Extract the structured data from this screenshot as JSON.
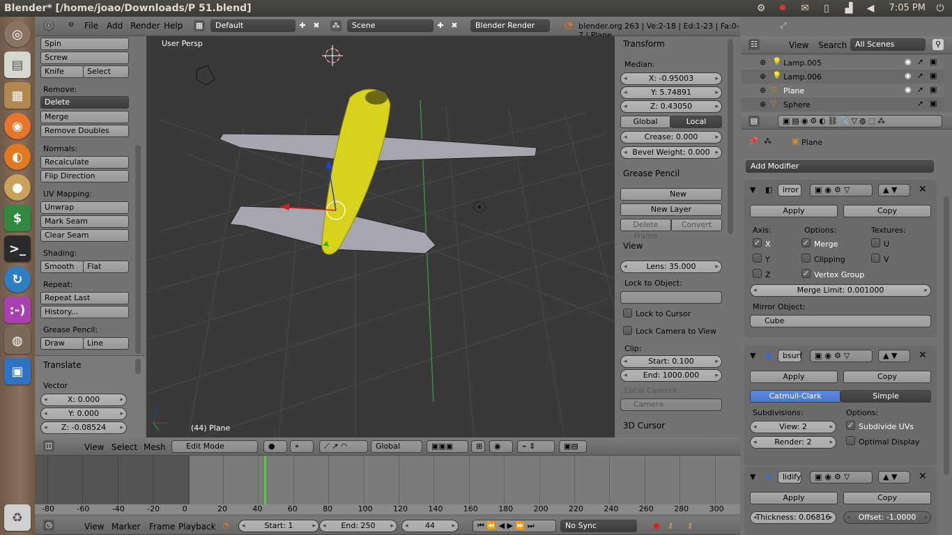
{
  "window": {
    "title": "Blender* [/home/joao/Downloads/P 51.blend]",
    "clock": "7:05 PM"
  },
  "tray_icons": [
    "gear-icon",
    "alert-icon",
    "mail-icon",
    "battery-icon",
    "signal-icon",
    "volume-icon",
    "power-icon"
  ],
  "launcher": [
    "dash",
    "files",
    "archive",
    "firefox",
    "blender",
    "cookie",
    "money",
    "terminal",
    "sync",
    "chat",
    "disc",
    "workspace",
    "trash"
  ],
  "info": {
    "menus": [
      "File",
      "Add",
      "Render",
      "Help"
    ],
    "layout": "Default",
    "scene": "Scene",
    "engine": "Blender Render",
    "stats": "blender.org 263 | Ve:2-18 | Ed:1-23 | Fa:0-7 | Plane"
  },
  "toolshelf": {
    "spin": "Spin",
    "screw": "Screw",
    "knife": "Knife",
    "select": "Select",
    "remove": "Remove:",
    "delete": "Delete",
    "merge": "Merge",
    "remove_doubles": "Remove Doubles",
    "normals": "Normals:",
    "recalculate": "Recalculate",
    "flip": "Flip Direction",
    "uv": "UV Mapping:",
    "unwrap": "Unwrap",
    "mark_seam": "Mark Seam",
    "clear_seam": "Clear Seam",
    "shading": "Shading:",
    "smooth": "Smooth",
    "flat": "Flat",
    "repeat": "Repeat:",
    "repeat_last": "Repeat Last",
    "history": "History...",
    "gp": "Grease Pencil:",
    "draw": "Draw",
    "line": "Line",
    "translate": "Translate",
    "vector": "Vector",
    "x": "X: 0.000",
    "y": "Y: 0.000",
    "z": "Z: -0.08524"
  },
  "viewport": {
    "label": "User Persp",
    "object": "(44) Plane"
  },
  "properties": {
    "transform": "Transform",
    "median": "Median:",
    "x": "X: -0.95003",
    "y": "Y: 5.74891",
    "z": "Z: 0.43050",
    "global": "Global",
    "local": "Local",
    "crease": "Crease: 0.000",
    "bevel": "Bevel Weight: 0.000",
    "grease": "Grease Pencil",
    "new": "New",
    "new_layer": "New Layer",
    "delete_frame": "Delete Frame",
    "convert": "Convert",
    "view": "View",
    "lens": "Lens: 35.000",
    "lock_obj": "Lock to Object:",
    "lock_cursor": "Lock to Cursor",
    "lock_cam": "Lock Camera to View",
    "clip": "Clip:",
    "start": "Start: 0.100",
    "end": "End: 1000.000",
    "local_cam": "Local Camera:",
    "camera": "Camera",
    "cursor": "3D Cursor"
  },
  "view3d_header": {
    "menus": [
      "View",
      "Select",
      "Mesh"
    ],
    "mode": "Edit Mode",
    "orientation": "Global"
  },
  "timeline": {
    "ticks": [
      "-80",
      "-60",
      "-40",
      "-20",
      "0",
      "20",
      "40",
      "60",
      "80",
      "100",
      "120",
      "140",
      "160",
      "180",
      "200",
      "220",
      "240",
      "260",
      "280",
      "300"
    ],
    "menus": [
      "View",
      "Marker",
      "Frame",
      "Playback"
    ],
    "start": "Start: 1",
    "end": "End: 250",
    "frame": "44",
    "sync": "No Sync",
    "current_frame": 44
  },
  "outliner": {
    "menus": [
      "View",
      "Search"
    ],
    "filter": "All Scenes",
    "items": [
      "Lamp.005",
      "Lamp.006",
      "Plane",
      "Sphere"
    ]
  },
  "modifiers": {
    "context": "Plane",
    "add": "Add Modifier",
    "mirror": {
      "name": "irror",
      "apply": "Apply",
      "copy": "Copy",
      "axis": "Axis:",
      "options": "Options:",
      "textures": "Textures:",
      "x": "X",
      "y": "Y",
      "z": "Z",
      "merge": "Merge",
      "clipping": "Clipping",
      "vgroup": "Vertex Group",
      "u": "U",
      "v": "V",
      "limit": "Merge Limit: 0.001000",
      "mobj": "Mirror Object:",
      "cube": "Cube"
    },
    "subsurf": {
      "name": "bsurf",
      "apply": "Apply",
      "copy": "Copy",
      "catmull": "Catmull-Clark",
      "simple": "Simple",
      "subdiv": "Subdivisions:",
      "options": "Options:",
      "view": "View: 2",
      "render": "Render: 2",
      "uvs": "Subdivide UVs",
      "optimal": "Optimal Display"
    },
    "solidify": {
      "name": "lidify",
      "apply": "Apply",
      "copy": "Copy",
      "thickness": "Thickness: 0.06816",
      "offset": "Offset: -1.0000"
    }
  }
}
